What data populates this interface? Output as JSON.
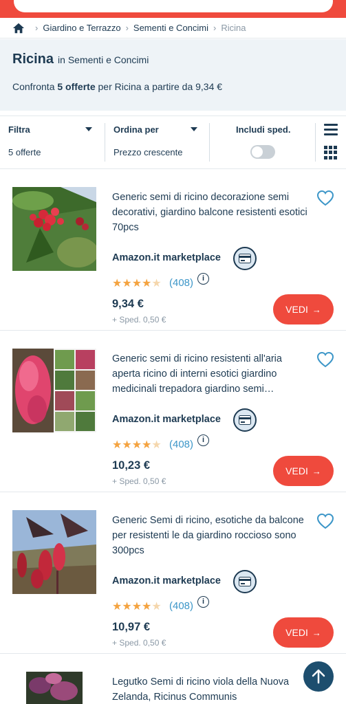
{
  "breadcrumb": {
    "items": [
      "Giardino e Terrazzo",
      "Sementi e Concimi"
    ],
    "current": "Ricina"
  },
  "header": {
    "title": "Ricina",
    "category_prefix": "in Sementi e Concimi",
    "compare_prefix": "Confronta ",
    "compare_count": "5 offerte",
    "compare_suffix": " per Ricina a partire da 9,34 €"
  },
  "filters": {
    "filter_label": "Filtra",
    "filter_value": "5 offerte",
    "sort_label": "Ordina per",
    "sort_value": "Prezzo crescente",
    "shipping_label": "Includi sped.",
    "shipping_enabled": false
  },
  "products": [
    {
      "title": "Generic semi di ricino decorazione semi decorativi, giardino balcone resistenti esotici 70pcs",
      "seller": "Amazon.it marketplace",
      "rating": 4,
      "reviews": "(408)",
      "price": "9,34 €",
      "shipping": "+ Sped. 0,50 €",
      "button": "VEDI"
    },
    {
      "title": "Generic semi di ricino resistenti all'aria aperta ricino di interni esotici giardino medicinali trepadora giardino semi…",
      "seller": "Amazon.it marketplace",
      "rating": 4,
      "reviews": "(408)",
      "price": "10,23 €",
      "shipping": "+ Sped. 0,50 €",
      "button": "VEDI"
    },
    {
      "title": "Generic Semi di ricino, esotiche da balcone per resistenti le da giardino roccioso sono 300pcs",
      "seller": "Amazon.it marketplace",
      "rating": 4,
      "reviews": "(408)",
      "price": "10,97 €",
      "shipping": "+ Sped. 0,50 €",
      "button": "VEDI"
    },
    {
      "title": "Legutko Semi di ricino viola della Nuova Zelanda, Ricinus Communis"
    }
  ],
  "colors": {
    "brand_red": "#ef4a3d",
    "navy": "#1d3a52",
    "link_blue": "#3c96c8",
    "star": "#f4a340"
  }
}
